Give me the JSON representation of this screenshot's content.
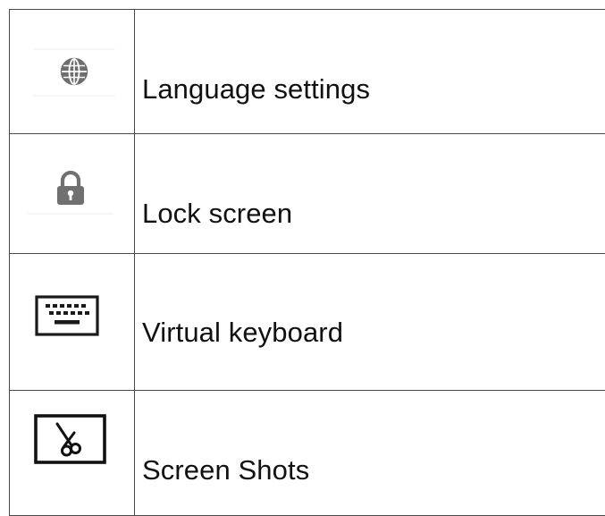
{
  "rows": [
    {
      "icon": "globe-icon",
      "label": "Language settings"
    },
    {
      "icon": "lock-icon",
      "label": "Lock screen"
    },
    {
      "icon": "keyboard-icon",
      "label": "Virtual keyboard"
    },
    {
      "icon": "scissors-icon",
      "label": "Screen Shots"
    }
  ],
  "colors": {
    "icon_gray": "#6e6e6e",
    "icon_dark": "#1a1a1a",
    "border": "#4a4a4a"
  }
}
